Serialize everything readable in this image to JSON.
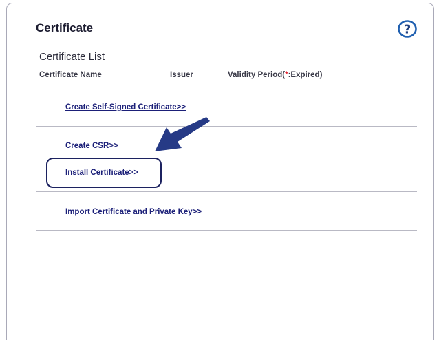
{
  "header": {
    "title": "Certificate",
    "help_icon": "help-question-icon"
  },
  "certificate_list": {
    "title": "Certificate List",
    "columns": {
      "name": "Certificate Name",
      "issuer": "Issuer",
      "validity_prefix": "Validity Period(",
      "validity_mark": "*",
      "validity_suffix": ":Expired)"
    }
  },
  "links": {
    "create_self_signed": "Create Self-Signed Certificate>>",
    "create_csr": "Create CSR>>",
    "install_certificate": "Install Certificate>>",
    "import_certificate": "Import Certificate and Private Key>>"
  },
  "annotation": {
    "arrow_icon": "pointer-arrow-icon",
    "arrow_color": "#263a86",
    "highlight_color": "#1c2260"
  },
  "colors": {
    "link": "#1b1f78",
    "expired_mark": "#e0202e",
    "help_icon": "#1f5fb0"
  }
}
